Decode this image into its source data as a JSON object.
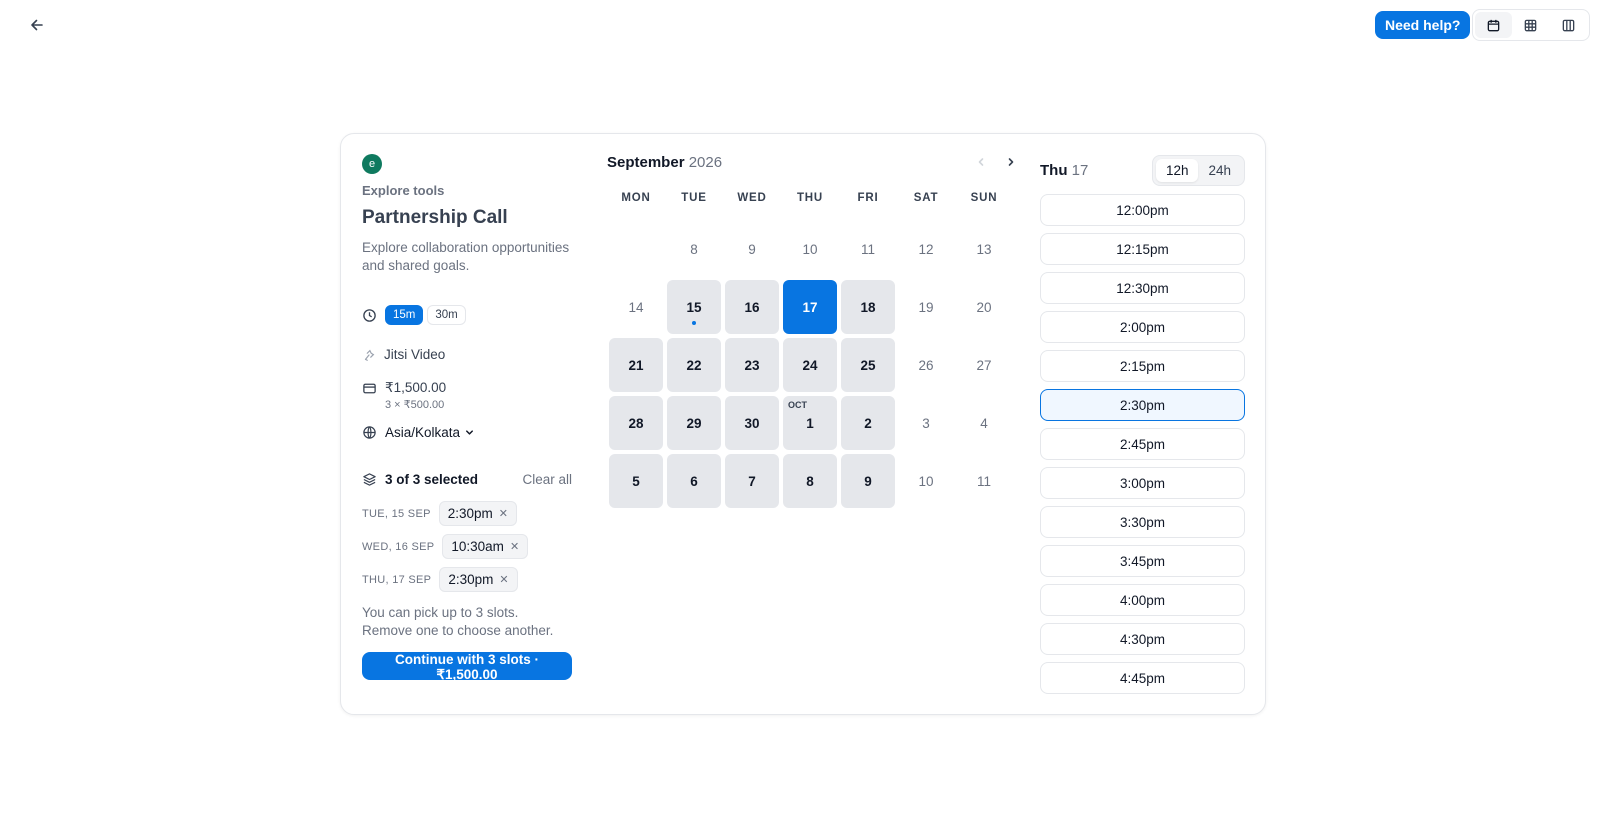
{
  "header": {
    "help_label": "Need help?"
  },
  "event": {
    "avatar_letter": "e",
    "org": "Explore tools",
    "title": "Partnership Call",
    "description": "Explore collaboration opportunities and shared goals.",
    "durations": [
      "15m",
      "30m"
    ],
    "location": "Jitsi Video",
    "price": "₹1,500.00",
    "price_breakdown": "3 × ₹500.00",
    "timezone": "Asia/Kolkata"
  },
  "selection": {
    "summary": "3 of 3 selected",
    "clear_label": "Clear all",
    "slots": [
      {
        "date": "TUE, 15 SEP",
        "time": "2:30pm"
      },
      {
        "date": "WED, 16 SEP",
        "time": "10:30am"
      },
      {
        "date": "THU, 17 SEP",
        "time": "2:30pm"
      }
    ],
    "note": "You can pick up to 3 slots. Remove one to choose another.",
    "continue_label": "Continue with 3 slots · ₹1,500.00"
  },
  "calendar": {
    "month": "September",
    "year": "2026",
    "weekdays": [
      "MON",
      "TUE",
      "WED",
      "THU",
      "FRI",
      "SAT",
      "SUN"
    ],
    "days": [
      {
        "n": "",
        "s": "empty"
      },
      {
        "n": "8",
        "s": "off"
      },
      {
        "n": "9",
        "s": "off"
      },
      {
        "n": "10",
        "s": "off"
      },
      {
        "n": "11",
        "s": "off"
      },
      {
        "n": "12",
        "s": "off"
      },
      {
        "n": "13",
        "s": "off"
      },
      {
        "n": "14",
        "s": "off"
      },
      {
        "n": "15",
        "s": "avail",
        "dot": true
      },
      {
        "n": "16",
        "s": "avail"
      },
      {
        "n": "17",
        "s": "selected"
      },
      {
        "n": "18",
        "s": "avail"
      },
      {
        "n": "19",
        "s": "off"
      },
      {
        "n": "20",
        "s": "off"
      },
      {
        "n": "21",
        "s": "avail"
      },
      {
        "n": "22",
        "s": "avail"
      },
      {
        "n": "23",
        "s": "avail"
      },
      {
        "n": "24",
        "s": "avail"
      },
      {
        "n": "25",
        "s": "avail"
      },
      {
        "n": "26",
        "s": "off"
      },
      {
        "n": "27",
        "s": "off"
      },
      {
        "n": "28",
        "s": "avail"
      },
      {
        "n": "29",
        "s": "avail"
      },
      {
        "n": "30",
        "s": "avail"
      },
      {
        "n": "1",
        "s": "avail",
        "month_label": "OCT"
      },
      {
        "n": "2",
        "s": "avail"
      },
      {
        "n": "3",
        "s": "off"
      },
      {
        "n": "4",
        "s": "off"
      },
      {
        "n": "5",
        "s": "avail"
      },
      {
        "n": "6",
        "s": "avail"
      },
      {
        "n": "7",
        "s": "avail"
      },
      {
        "n": "8",
        "s": "avail"
      },
      {
        "n": "9",
        "s": "avail"
      },
      {
        "n": "10",
        "s": "off"
      },
      {
        "n": "11",
        "s": "off"
      }
    ]
  },
  "times": {
    "day_name": "Thu",
    "day_num": "17",
    "formats": [
      "12h",
      "24h"
    ],
    "active_format": "12h",
    "slots": [
      "12:00pm",
      "12:15pm",
      "12:30pm",
      "2:00pm",
      "2:15pm",
      "2:30pm",
      "2:45pm",
      "3:00pm",
      "3:30pm",
      "3:45pm",
      "4:00pm",
      "4:30pm",
      "4:45pm"
    ],
    "active_slot": "2:30pm"
  },
  "colors": {
    "accent": "#0875e1",
    "avatar": "#0f7a5f"
  }
}
